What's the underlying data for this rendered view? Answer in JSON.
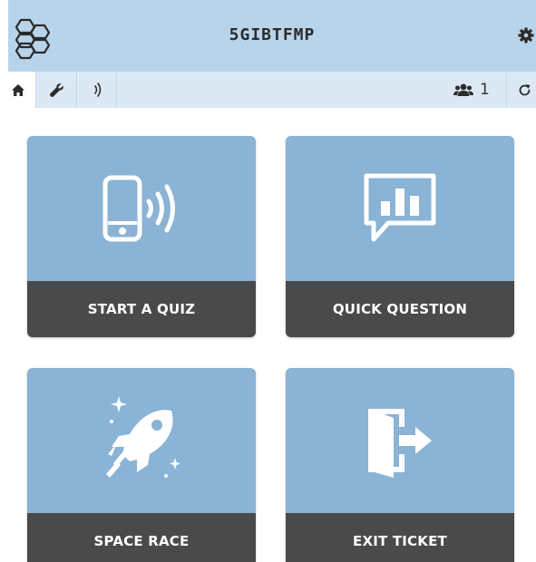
{
  "header": {
    "room_name": "5GIBTFMP",
    "logo_icon": "hexagon-cluster-icon",
    "settings_icon": "gear-icon",
    "background": "#b8d4ea"
  },
  "toolbar": {
    "tabs": [
      {
        "icon": "home-icon",
        "active": true
      },
      {
        "icon": "wrench-icon",
        "active": false
      },
      {
        "icon": "live-signal-icon",
        "active": false
      }
    ],
    "student_count": "1",
    "students_icon": "users-icon",
    "refresh_icon": "refresh-icon"
  },
  "tiles": [
    {
      "label": "START A QUIZ",
      "icon": "phone-broadcast-icon"
    },
    {
      "label": "QUICK QUESTION",
      "icon": "chart-speech-bubble-icon"
    },
    {
      "label": "SPACE RACE",
      "icon": "rocket-icon"
    },
    {
      "label": "EXIT TICKET",
      "icon": "exit-door-icon"
    }
  ],
  "colors": {
    "tile_bg": "#8ab3d5",
    "tile_bar": "#4a4a4a",
    "toolbar_bg": "#dce9f5"
  }
}
